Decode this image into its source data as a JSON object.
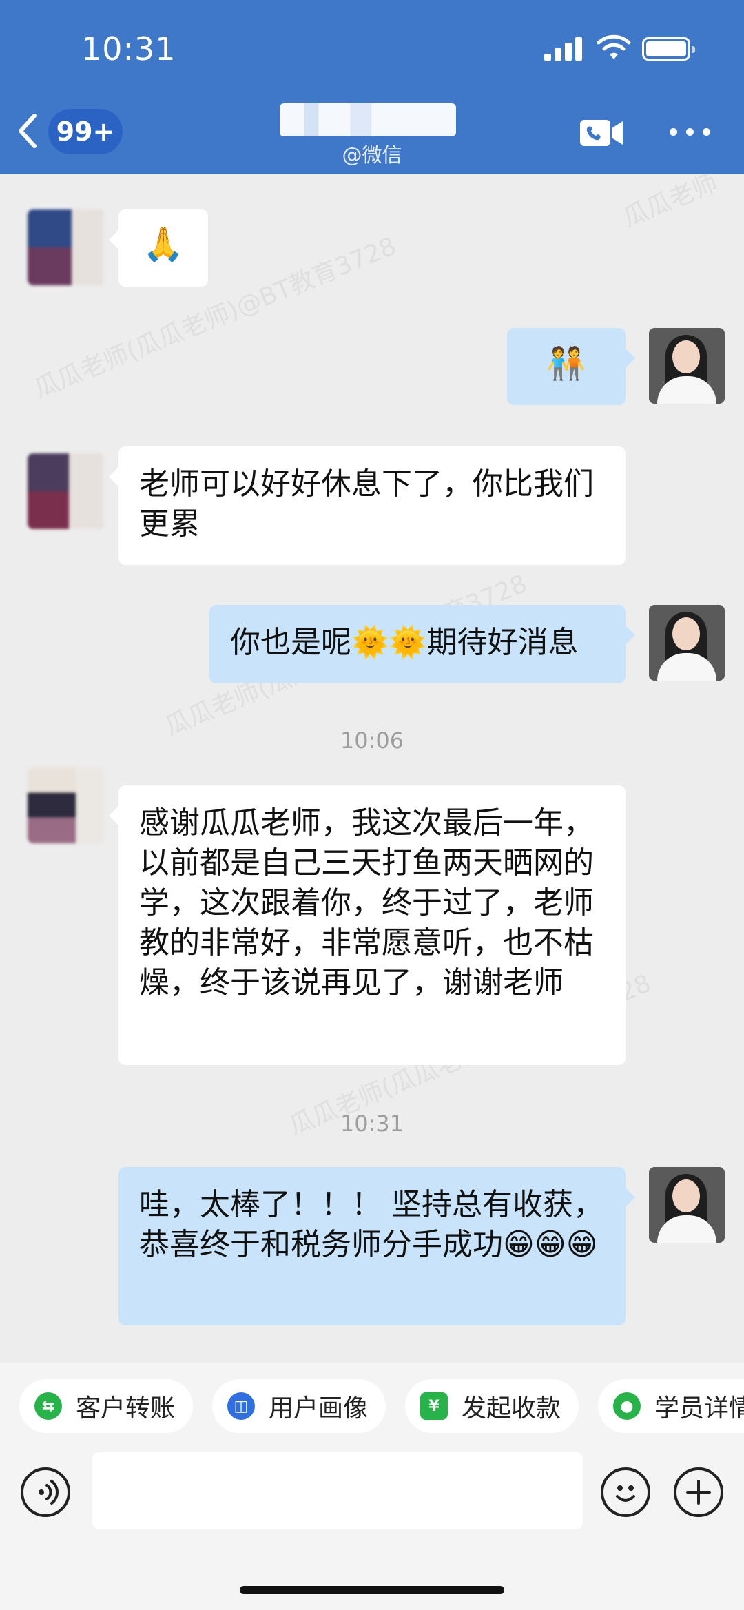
{
  "status_bar": {
    "time": "10:31"
  },
  "header": {
    "unread_count": "99+",
    "contact_source": "@微信",
    "icons": [
      "back-chevron-icon",
      "video-call-icon",
      "more-dots-icon"
    ]
  },
  "watermarks": [
    "瓜瓜老师(瓜瓜老师)@BT教育3728",
    "瓜瓜老师"
  ],
  "messages": [
    {
      "direction": "incoming",
      "type": "emoji",
      "text": "🙏"
    },
    {
      "direction": "outgoing",
      "type": "emoji",
      "text": "🧑‍🤝‍🧑"
    },
    {
      "direction": "incoming",
      "type": "text",
      "text": "老师可以好好休息下了，你比我们更累"
    },
    {
      "direction": "outgoing",
      "type": "text",
      "text": "你也是呢🌞🌞期待好消息"
    },
    {
      "type": "time",
      "text": "10:06"
    },
    {
      "direction": "incoming",
      "type": "text",
      "text": "感谢瓜瓜老师，我这次最后一年，以前都是自己三天打鱼两天晒网的学，这次跟着你，终于过了，老师教的非常好，非常愿意听，也不枯燥，终于该说再见了，谢谢老师"
    },
    {
      "type": "time",
      "text": "10:31"
    },
    {
      "direction": "outgoing",
      "type": "text",
      "text": "哇，太棒了！！！ 坚持总有收获，恭喜终于和税务师分手成功😁😁😁"
    }
  ],
  "quick_actions": [
    {
      "label": "客户转账",
      "icon": "transfer-icon",
      "color": "#27b24a"
    },
    {
      "label": "用户画像",
      "icon": "profile-icon",
      "color": "#2f6fe0"
    },
    {
      "label": "发起收款",
      "icon": "collect-payment-icon",
      "color": "#27b24a"
    },
    {
      "label": "学员详情",
      "icon": "student-details-icon",
      "color": "#27b24a"
    }
  ],
  "input_bar": {
    "placeholder": ""
  }
}
